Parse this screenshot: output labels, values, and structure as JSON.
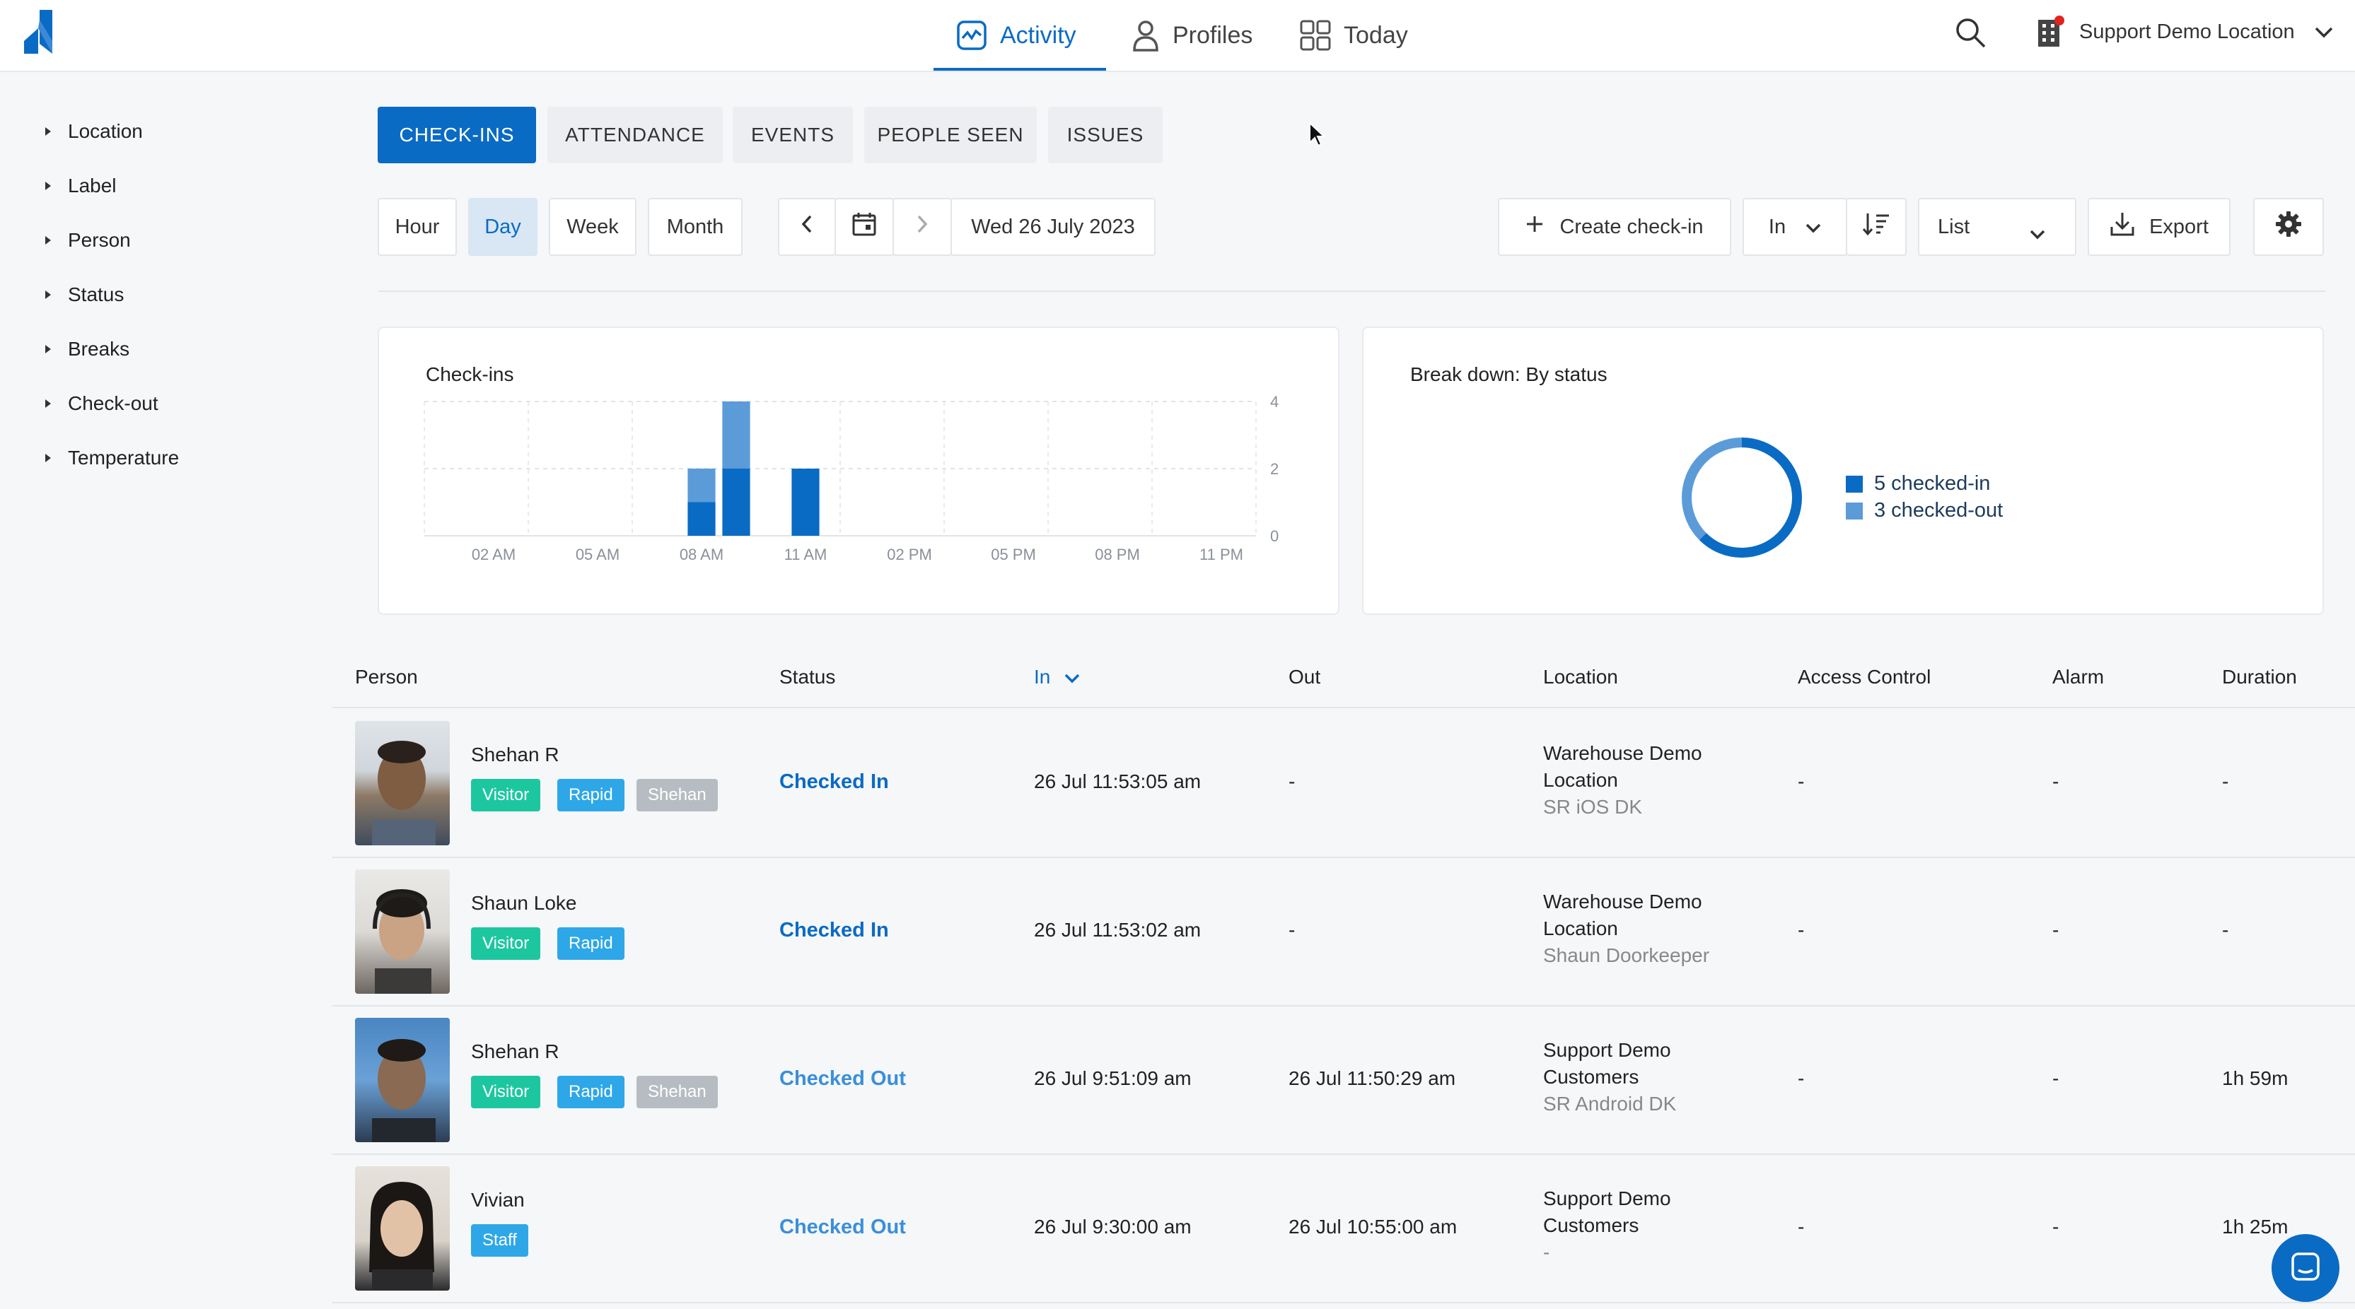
{
  "header": {
    "nav": [
      {
        "label": "Activity",
        "icon": "activity-icon"
      },
      {
        "label": "Profiles",
        "icon": "person-icon"
      },
      {
        "label": "Today",
        "icon": "grid-icon"
      }
    ],
    "location": "Support Demo Location"
  },
  "sidebar": {
    "items": [
      {
        "label": "Location"
      },
      {
        "label": "Label"
      },
      {
        "label": "Person"
      },
      {
        "label": "Status"
      },
      {
        "label": "Breaks"
      },
      {
        "label": "Check-out"
      },
      {
        "label": "Temperature"
      }
    ]
  },
  "tabs": [
    {
      "label": "CHECK-INS",
      "active": true
    },
    {
      "label": "ATTENDANCE"
    },
    {
      "label": "EVENTS"
    },
    {
      "label": "PEOPLE SEEN"
    },
    {
      "label": "ISSUES"
    }
  ],
  "toolbar": {
    "ranges": [
      {
        "label": "Hour"
      },
      {
        "label": "Day",
        "selected": true
      },
      {
        "label": "Week"
      },
      {
        "label": "Month"
      }
    ],
    "date": "Wed 26 July 2023",
    "create": "Create check-in",
    "direction": "In",
    "view": "List",
    "export": "Export"
  },
  "cards": {
    "checkins_title": "Check-ins",
    "breakdown_title": "Break down: By status",
    "legend": [
      {
        "label": "5 checked-in",
        "color": "#0a6bc4"
      },
      {
        "label": "3 checked-out",
        "color": "#5b9bd8"
      }
    ]
  },
  "chart_data": [
    {
      "type": "bar",
      "title": "Check-ins",
      "x": [
        "02 AM",
        "05 AM",
        "08 AM",
        "11 AM",
        "02 PM",
        "05 PM",
        "08 PM",
        "11 PM"
      ],
      "y_ticks": [
        "4",
        "2",
        "0"
      ],
      "ylim": [
        0,
        4
      ],
      "stacked": true,
      "bars": [
        {
          "hour": 8,
          "checked_in": 1,
          "checked_out": 1
        },
        {
          "hour": 9,
          "checked_in": 2,
          "checked_out": 2
        },
        {
          "hour": 11,
          "checked_in": 2,
          "checked_out": 0
        }
      ],
      "colors": {
        "checked_in": "#0a6bc4",
        "checked_out": "#5b9bd8"
      },
      "grid": true
    },
    {
      "type": "pie",
      "title": "Break down: By status",
      "labels": [
        "checked-in",
        "checked-out"
      ],
      "values": [
        5,
        3
      ],
      "colors": [
        "#0a6bc4",
        "#5b9bd8"
      ]
    }
  ],
  "table": {
    "headers": {
      "person": "Person",
      "status": "Status",
      "in": "In",
      "out": "Out",
      "location": "Location",
      "access": "Access Control",
      "alarm": "Alarm",
      "duration": "Duration"
    },
    "rows": [
      {
        "name": "Shehan R",
        "badges": [
          "Visitor",
          "Rapid",
          "Shehan"
        ],
        "status": "Checked In",
        "in": "26 Jul 11:53:05 am",
        "out": "-",
        "loc1": "Warehouse Demo",
        "loc2": "Location",
        "device": "SR iOS DK",
        "access": "-",
        "alarm": "-",
        "duration": "-"
      },
      {
        "name": "Shaun Loke",
        "badges": [
          "Visitor",
          "Rapid"
        ],
        "status": "Checked In",
        "in": "26 Jul 11:53:02 am",
        "out": "-",
        "loc1": "Warehouse Demo",
        "loc2": "Location",
        "device": "Shaun Doorkeeper",
        "access": "-",
        "alarm": "-",
        "duration": "-"
      },
      {
        "name": "Shehan R",
        "badges": [
          "Visitor",
          "Rapid",
          "Shehan"
        ],
        "status": "Checked Out",
        "in": "26 Jul 9:51:09 am",
        "out": "26 Jul 11:50:29 am",
        "loc1": "Support Demo",
        "loc2": "Customers",
        "device": "SR Android DK",
        "access": "-",
        "alarm": "-",
        "duration": "1h 59m"
      },
      {
        "name": "Vivian",
        "badges": [
          "Staff"
        ],
        "status": "Checked Out",
        "in": "26 Jul 9:30:00 am",
        "out": "26 Jul 10:55:00 am",
        "loc1": "Support Demo",
        "loc2": "Customers",
        "device": "-",
        "access": "-",
        "alarm": "-",
        "duration": "1h 25m"
      }
    ]
  },
  "badge_colors": {
    "Visitor": "#1cc7a0",
    "Rapid": "#2ea7e8",
    "Shehan": "#b7bcc2",
    "Staff": "#2ea7e8"
  }
}
